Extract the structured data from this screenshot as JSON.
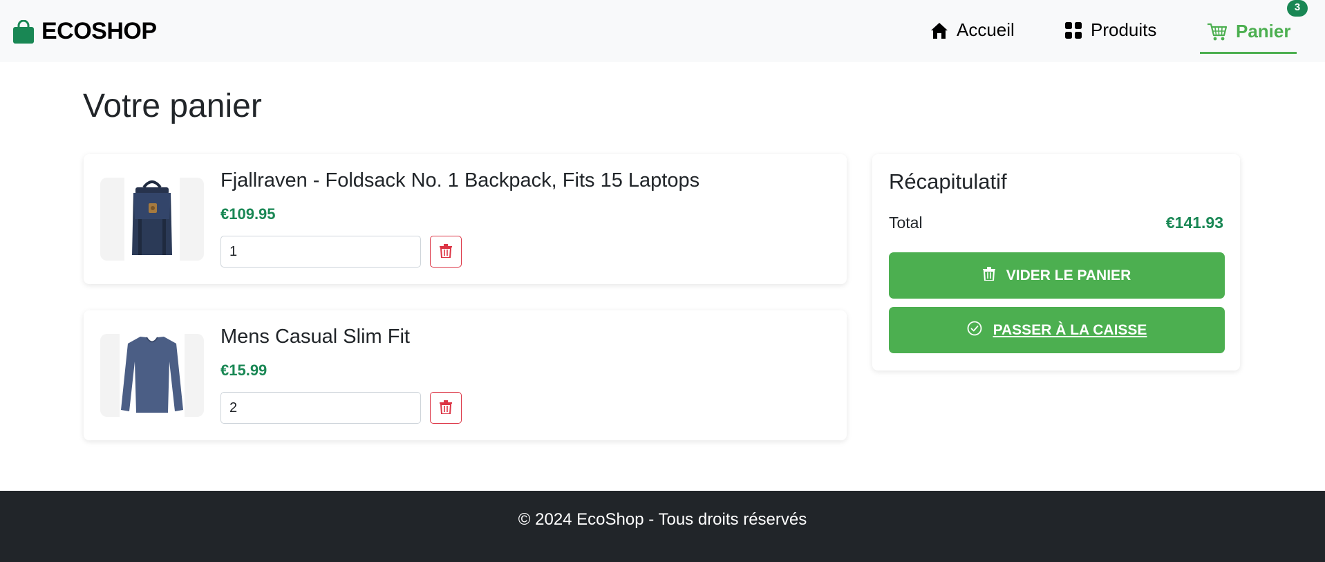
{
  "header": {
    "brand": "ECOSHOP",
    "nav": {
      "home": "Accueil",
      "products": "Produits",
      "cart": "Panier"
    },
    "cart_count": "3"
  },
  "page": {
    "title": "Votre panier"
  },
  "cart": {
    "items": [
      {
        "title": "Fjallraven - Foldsack No. 1 Backpack, Fits 15 Laptops",
        "price": "€109.95",
        "quantity": "1",
        "image": "backpack-image"
      },
      {
        "title": "Mens Casual Slim Fit",
        "price": "€15.99",
        "quantity": "2",
        "image": "shirt-image"
      }
    ]
  },
  "summary": {
    "title": "Récapitulatif",
    "total_label": "Total",
    "total_value": "€141.93",
    "empty_button": "VIDER LE PANIER",
    "checkout_button": "PASSER À LA CAISSE"
  },
  "footer": {
    "text": "© 2024 EcoShop - Tous droits réservés"
  },
  "colors": {
    "brand_green": "#4caf50",
    "price_green": "#198754",
    "danger": "#dc3545",
    "footer_bg": "#212529",
    "navbar_bg": "#f8f9fa"
  },
  "icons": {
    "brand": "shopping-bag-icon",
    "home": "house-icon",
    "products": "grid-icon",
    "cart": "cart-icon",
    "delete": "trash-icon",
    "checkout": "check-circle-icon"
  }
}
